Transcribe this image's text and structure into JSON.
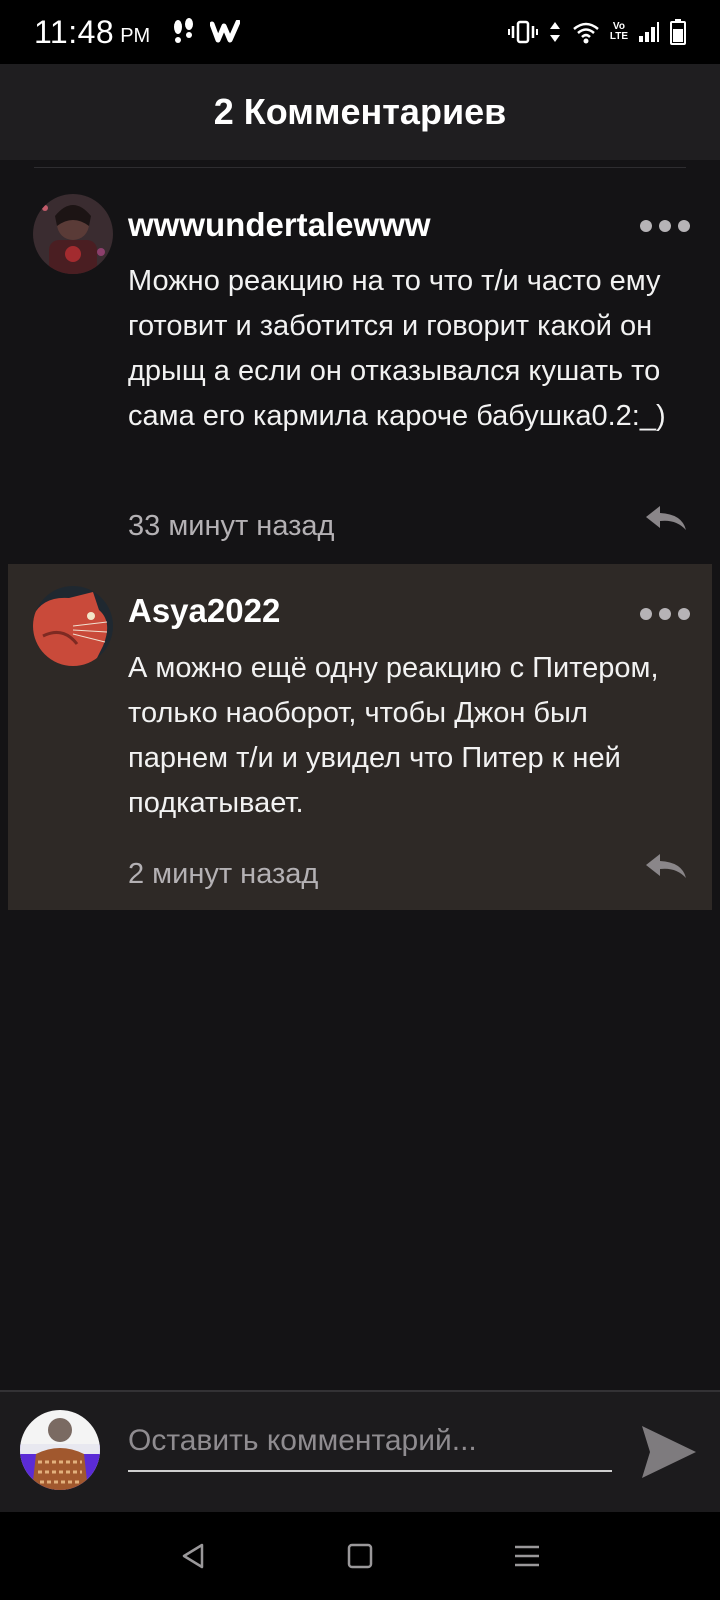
{
  "status_bar": {
    "time": "11:48",
    "ampm": "PM",
    "lte_top": "Vo",
    "lte_bottom": "LTE",
    "icons": [
      "footprint-icon",
      "wattpad-icon",
      "vibrate-icon",
      "data-arrows-icon",
      "wifi-icon",
      "signal-icon",
      "battery-icon"
    ]
  },
  "header": {
    "title": "2 Комментариев"
  },
  "comments": [
    {
      "username": "wwwundertalewww",
      "text": "Можно реакцию на то что т/и часто ему готовит и заботится и говорит  какой он дрыщ а если он отказывался кушать то сама его кармила кароче бабушка0.2:_)",
      "time": "33 минут назад",
      "highlighted": false
    },
    {
      "username": "Asya2022",
      "text": "А можно ещё одну реакцию с Питером, только наоборот, чтобы Джон был парнем т/и и увидел что Питер к ней подкатывает.",
      "time": "2 минут назад",
      "highlighted": true
    }
  ],
  "composer": {
    "placeholder": "Оставить комментарий..."
  },
  "nav": [
    "back-icon",
    "home-icon",
    "menu-icon"
  ],
  "colors": {
    "background": "#141315",
    "header": "#1f1e20",
    "highlight": "#2e2926",
    "muted_text": "#b4b1b4"
  }
}
